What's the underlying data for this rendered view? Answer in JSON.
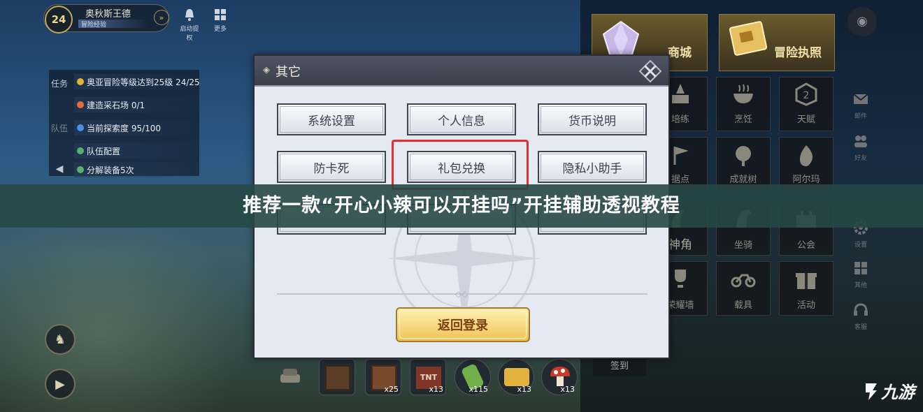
{
  "player": {
    "level": "24",
    "name": "奥秋斯王德",
    "title": "冒险经验"
  },
  "top_buttons": [
    {
      "label": "启动提权",
      "icon": "bell-icon"
    },
    {
      "label": "更多",
      "icon": "grid-icon"
    }
  ],
  "tasks": {
    "tabs": [
      "任务",
      "队伍"
    ],
    "items": [
      {
        "text": "奥亚冒险等级达到25级 24/25",
        "color": "#e0b23a"
      },
      {
        "text": "建造采石场 0/1",
        "color": "#e26b3a"
      },
      {
        "text": "当前探索度 95/100",
        "color": "#4a8fe0"
      },
      {
        "text": "队伍配置",
        "color": "#58b070"
      },
      {
        "text": "分解装备5次",
        "color": "#58b070"
      }
    ]
  },
  "dialog": {
    "title": "其它",
    "options": [
      "系统设置",
      "个人信息",
      "货币说明",
      "防卡死",
      "礼包兑换",
      "隐私小助手"
    ],
    "return_label": "返回登录"
  },
  "shop": {
    "store_label": "商城",
    "license_label": "冒险执照"
  },
  "menu_labels": [
    "培练",
    "烹饪",
    "天赋",
    "据点",
    "成就树",
    "阿尔玛",
    "神角",
    "坐骑",
    "公会",
    "荣耀墙",
    "载具",
    "活动"
  ],
  "side_items": [
    "邮件",
    "好友",
    "设置",
    "其他",
    "客服"
  ],
  "bottom_items": [
    {
      "count": ""
    },
    {
      "count": "x25"
    },
    {
      "count": "x13"
    },
    {
      "count": "x115"
    },
    {
      "count": "x13"
    },
    {
      "count": "x13"
    }
  ],
  "signin_label": "签到",
  "banner": {
    "text": "推荐一款“开心小辣可以开挂吗”开挂辅助透视教程"
  },
  "logo_text": "九游",
  "colors": {
    "highlight": "#e42d2d",
    "banner_bg": "#264846",
    "return_button": "#efc356"
  }
}
